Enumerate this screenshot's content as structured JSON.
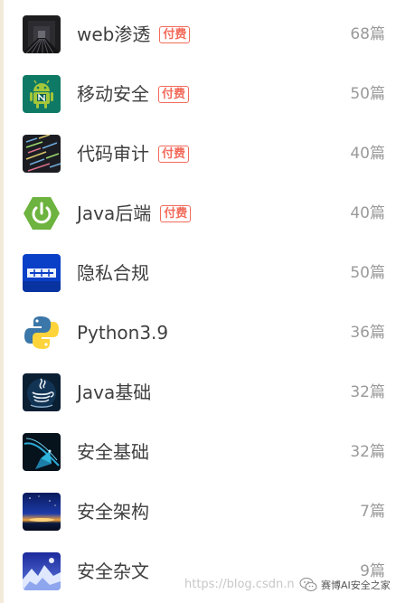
{
  "categories": [
    {
      "name": "web渗透",
      "badge": "付费",
      "count": "68篇",
      "icon": "dark-tunnel-image-icon"
    },
    {
      "name": "移动安全",
      "badge": "付费",
      "count": "50篇",
      "icon": "android-robot-icon"
    },
    {
      "name": "代码审计",
      "badge": "付费",
      "count": "40篇",
      "icon": "code-screen-image-icon"
    },
    {
      "name": "Java后端",
      "badge": "付费",
      "count": "40篇",
      "icon": "spring-power-icon"
    },
    {
      "name": "隐私合规",
      "badge": "",
      "count": "50篇",
      "icon": "privacy-compliance-icon"
    },
    {
      "name": "Python3.9",
      "badge": "",
      "count": "36篇",
      "icon": "python-logo-icon"
    },
    {
      "name": "Java基础",
      "badge": "",
      "count": "32篇",
      "icon": "java-logo-icon"
    },
    {
      "name": "安全基础",
      "badge": "",
      "count": "32篇",
      "icon": "blue-abstract-image-icon"
    },
    {
      "name": "安全架构",
      "badge": "",
      "count": "7篇",
      "icon": "sunrise-image-icon"
    },
    {
      "name": "安全杂文",
      "badge": "",
      "count": "9篇",
      "icon": "snow-mountain-image-icon"
    }
  ],
  "watermark": {
    "url_text": "https://blog.csdn.n",
    "brand_text": "赛博AI安全之家"
  },
  "colors": {
    "badge": "#f26b5b",
    "name_text": "#3f3f3f",
    "count_text": "#9a9a9a"
  }
}
